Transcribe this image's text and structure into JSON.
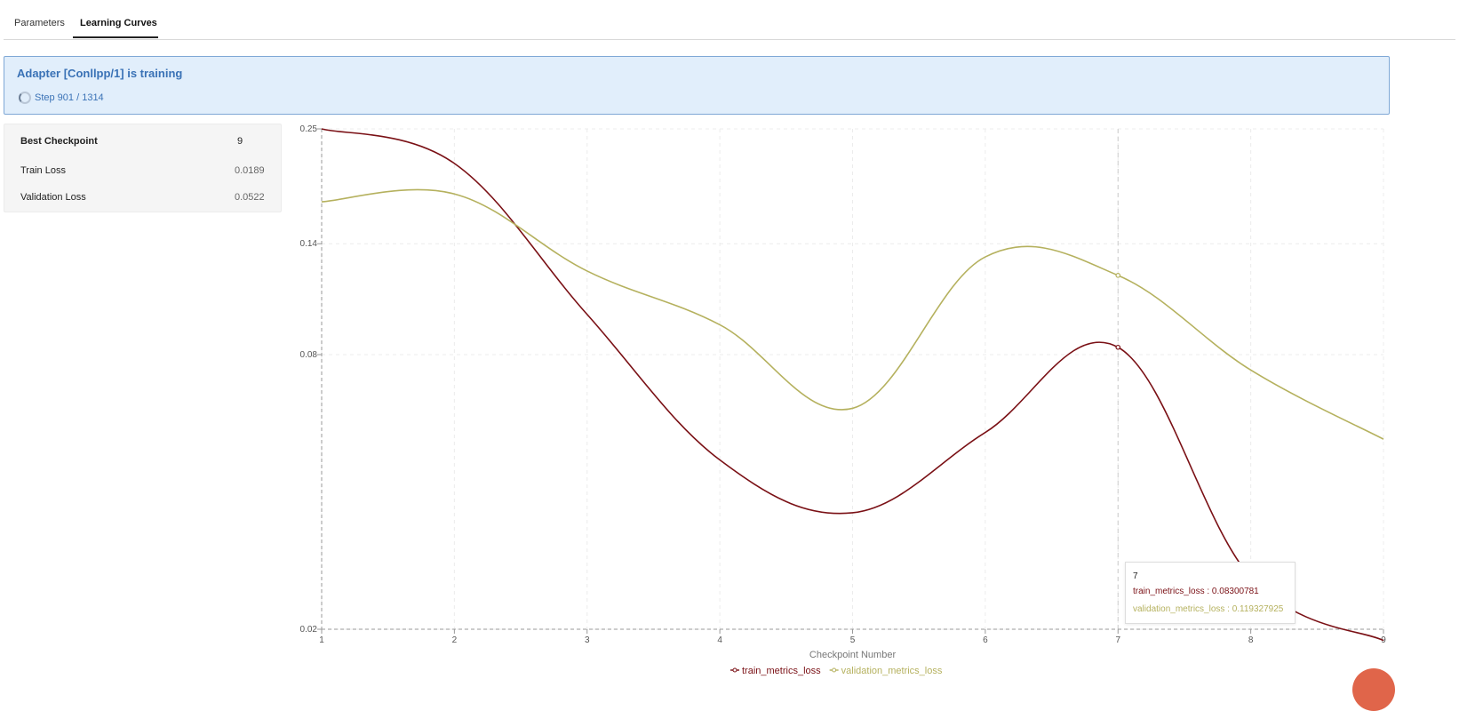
{
  "tabs": [
    {
      "label": "Parameters",
      "active": false
    },
    {
      "label": "Learning Curves",
      "active": true
    }
  ],
  "banner": {
    "title": "Adapter [Conllpp/1] is training",
    "step": "Step 901 / 1314"
  },
  "stats": {
    "best_checkpoint_label": "Best Checkpoint",
    "best_checkpoint_value": "9",
    "train_loss_label": "Train Loss",
    "train_loss_value": "0.0189",
    "validation_loss_label": "Validation Loss",
    "validation_loss_value": "0.0522"
  },
  "tooltip": {
    "x": "7",
    "train": "train_metrics_loss : 0.08300781",
    "validation": "validation_metrics_loss : 0.119327925"
  },
  "chart_data": {
    "type": "line",
    "xlabel": "Checkpoint Number",
    "ylabel": "",
    "x": [
      1,
      2,
      3,
      4,
      5,
      6,
      7,
      8,
      9
    ],
    "x_ticks": [
      "1",
      "2",
      "3",
      "4",
      "5",
      "6",
      "7",
      "8",
      "9"
    ],
    "y_ticks": [
      "0.02",
      "0.08",
      "0.14",
      "0.25"
    ],
    "y_scale": "log",
    "ylim": [
      0.02,
      0.25
    ],
    "grid": true,
    "legend_position": "bottom-center",
    "series": [
      {
        "name": "train_metrics_loss",
        "color": "#7a1015",
        "values": [
          0.25,
          0.21,
          0.098,
          0.047,
          0.036,
          0.054,
          0.08300781,
          0.026,
          0.0189
        ]
      },
      {
        "name": "validation_metrics_loss",
        "color": "#b5b15e",
        "values": [
          0.173,
          0.18,
          0.122,
          0.093,
          0.061,
          0.131,
          0.119327925,
          0.074,
          0.0522
        ]
      }
    ],
    "highlight_x": 7
  },
  "colors": {
    "accent_blue": "#3a72b6",
    "banner_bg": "#e1eefb",
    "train": "#7a1015",
    "validation": "#b5b15e"
  }
}
